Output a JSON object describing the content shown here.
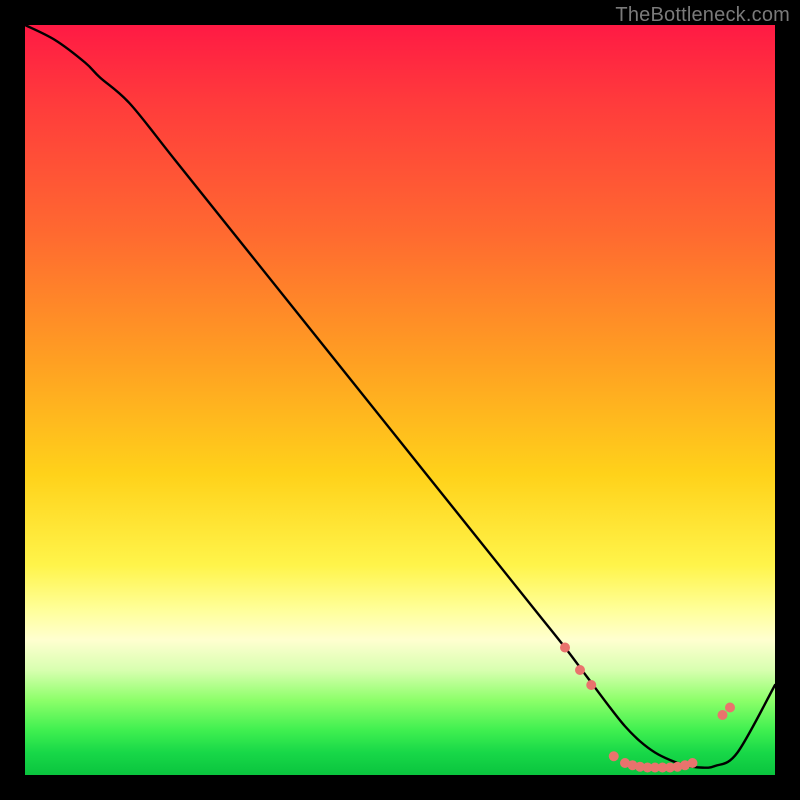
{
  "watermark": "TheBottleneck.com",
  "chart_data": {
    "type": "line",
    "title": "",
    "xlabel": "",
    "ylabel": "",
    "xlim": [
      0,
      100
    ],
    "ylim": [
      0,
      100
    ],
    "grid": false,
    "legend": false,
    "series": [
      {
        "name": "bottleneck-curve",
        "color": "#000000",
        "x": [
          0,
          4,
          8,
          10,
          14,
          20,
          30,
          40,
          50,
          60,
          68,
          72,
          75,
          78,
          80,
          82,
          84,
          86,
          88,
          90,
          92,
          95,
          100
        ],
        "y": [
          100,
          98,
          95,
          93,
          89.5,
          82,
          69.5,
          57,
          44.5,
          32,
          22,
          17,
          13,
          9,
          6.5,
          4.5,
          3,
          2,
          1.3,
          1,
          1.2,
          3,
          12
        ]
      }
    ],
    "markers": {
      "name": "highlight-dots",
      "color": "#e9736d",
      "radius": 5,
      "points": [
        {
          "x": 72,
          "y": 17
        },
        {
          "x": 74,
          "y": 14
        },
        {
          "x": 75.5,
          "y": 12
        },
        {
          "x": 78.5,
          "y": 2.5
        },
        {
          "x": 80,
          "y": 1.6
        },
        {
          "x": 81,
          "y": 1.3
        },
        {
          "x": 82,
          "y": 1.1
        },
        {
          "x": 83,
          "y": 1.0
        },
        {
          "x": 84,
          "y": 1.0
        },
        {
          "x": 85,
          "y": 1.0
        },
        {
          "x": 86,
          "y": 1.0
        },
        {
          "x": 87,
          "y": 1.1
        },
        {
          "x": 88,
          "y": 1.3
        },
        {
          "x": 89,
          "y": 1.6
        },
        {
          "x": 93,
          "y": 8
        },
        {
          "x": 94,
          "y": 9
        }
      ]
    }
  }
}
